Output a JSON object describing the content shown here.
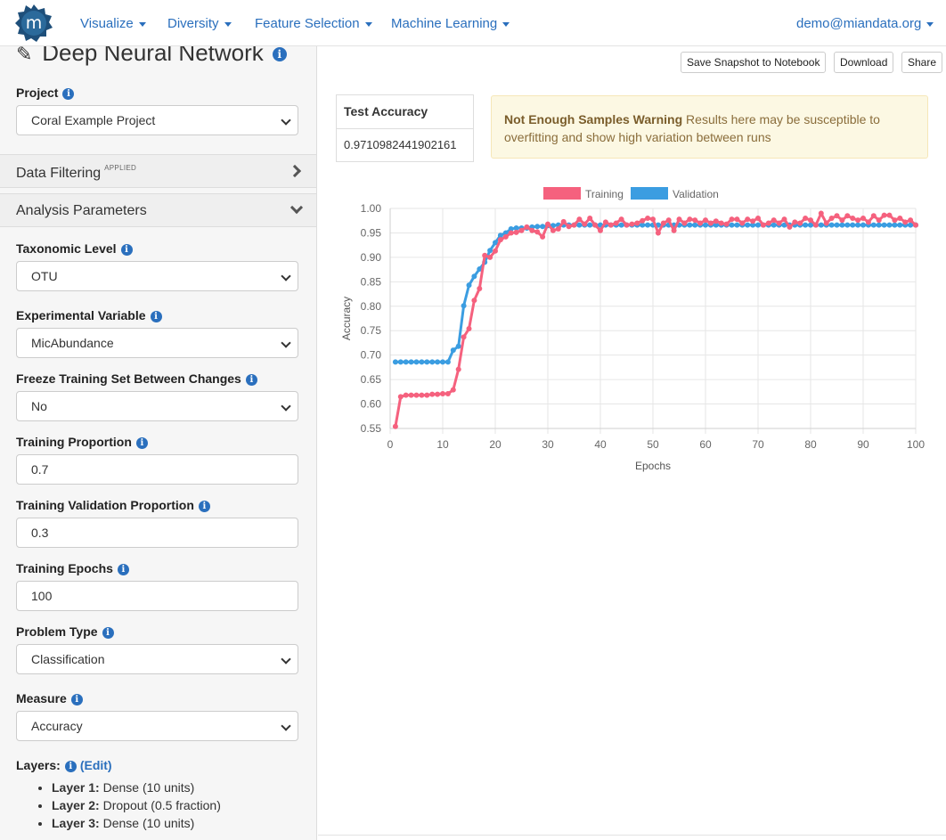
{
  "nav": {
    "logo_letter": "m",
    "items": [
      {
        "label": "Visualize"
      },
      {
        "label": "Diversity"
      },
      {
        "label": "Feature Selection"
      },
      {
        "label": "Machine Learning"
      }
    ],
    "user": "demo@miandata.org"
  },
  "sidebar": {
    "page_title": "Deep Neural Network",
    "project": {
      "label": "Project",
      "value": "Coral Example Project"
    },
    "data_filtering": {
      "title": "Data Filtering",
      "badge": "APPLIED"
    },
    "analysis_parameters": {
      "title": "Analysis Parameters"
    },
    "fields": {
      "taxonomic_level": {
        "label": "Taxonomic Level",
        "value": "OTU"
      },
      "experimental_variable": {
        "label": "Experimental Variable",
        "value": "MicAbundance"
      },
      "freeze_training": {
        "label": "Freeze Training Set Between Changes",
        "value": "No"
      },
      "training_proportion": {
        "label": "Training Proportion",
        "value": "0.7"
      },
      "training_validation_proportion": {
        "label": "Training Validation Proportion",
        "value": "0.3"
      },
      "training_epochs": {
        "label": "Training Epochs",
        "value": "100"
      },
      "problem_type": {
        "label": "Problem Type",
        "value": "Classification"
      },
      "measure": {
        "label": "Measure",
        "value": "Accuracy"
      }
    },
    "layers": {
      "label": "Layers:",
      "edit": "(Edit)",
      "items": [
        {
          "name": "Layer 1:",
          "desc": "Dense (10 units)"
        },
        {
          "name": "Layer 2:",
          "desc": "Dropout (0.5 fraction)"
        },
        {
          "name": "Layer 3:",
          "desc": "Dense (10 units)"
        }
      ]
    }
  },
  "toolbar": {
    "save_snapshot": "Save Snapshot to Notebook",
    "download": "Download",
    "share": "Share"
  },
  "results": {
    "test_accuracy_label": "Test Accuracy",
    "test_accuracy_value": "0.9710982441902161",
    "warning_title": "Not Enough Samples Warning",
    "warning_text": "Results here may be susceptible to overfitting and show high variation between runs"
  },
  "colors": {
    "training": "#f5617e",
    "validation": "#3b9de1",
    "link": "#2a6fbd"
  },
  "chart_data": {
    "type": "line",
    "xlabel": "Epochs",
    "ylabel": "Accuracy",
    "xlim": [
      0,
      100
    ],
    "ylim": [
      0.55,
      1.0
    ],
    "xticks": [
      0,
      10,
      20,
      30,
      40,
      50,
      60,
      70,
      80,
      90,
      100
    ],
    "yticks": [
      0.55,
      0.6,
      0.65,
      0.7,
      0.75,
      0.8,
      0.85,
      0.9,
      0.95,
      1.0
    ],
    "legend_position": "top",
    "grid": true,
    "x": [
      1,
      2,
      3,
      4,
      5,
      6,
      7,
      8,
      9,
      10,
      11,
      12,
      13,
      14,
      15,
      16,
      17,
      18,
      19,
      20,
      21,
      22,
      23,
      24,
      25,
      26,
      27,
      28,
      29,
      30,
      31,
      32,
      33,
      34,
      35,
      36,
      37,
      38,
      39,
      40,
      41,
      42,
      43,
      44,
      45,
      46,
      47,
      48,
      49,
      50,
      51,
      52,
      53,
      54,
      55,
      56,
      57,
      58,
      59,
      60,
      61,
      62,
      63,
      64,
      65,
      66,
      67,
      68,
      69,
      70,
      71,
      72,
      73,
      74,
      75,
      76,
      77,
      78,
      79,
      80,
      81,
      82,
      83,
      84,
      85,
      86,
      87,
      88,
      89,
      90,
      91,
      92,
      93,
      94,
      95,
      96,
      97,
      98,
      99,
      100
    ],
    "series": [
      {
        "name": "Training",
        "values": [
          0.554,
          0.615,
          0.618,
          0.618,
          0.618,
          0.618,
          0.618,
          0.62,
          0.62,
          0.621,
          0.621,
          0.629,
          0.671,
          0.737,
          0.754,
          0.812,
          0.836,
          0.904,
          0.9,
          0.913,
          0.936,
          0.942,
          0.95,
          0.951,
          0.955,
          0.962,
          0.955,
          0.952,
          0.942,
          0.968,
          0.955,
          0.958,
          0.973,
          0.963,
          0.966,
          0.978,
          0.968,
          0.98,
          0.966,
          0.955,
          0.972,
          0.966,
          0.97,
          0.978,
          0.966,
          0.968,
          0.97,
          0.975,
          0.98,
          0.978,
          0.95,
          0.97,
          0.976,
          0.955,
          0.978,
          0.97,
          0.978,
          0.976,
          0.97,
          0.976,
          0.97,
          0.974,
          0.97,
          0.968,
          0.978,
          0.978,
          0.97,
          0.978,
          0.974,
          0.98,
          0.966,
          0.97,
          0.976,
          0.97,
          0.978,
          0.962,
          0.972,
          0.97,
          0.98,
          0.976,
          0.966,
          0.99,
          0.97,
          0.98,
          0.985,
          0.976,
          0.985,
          0.98,
          0.976,
          0.98,
          0.972,
          0.985,
          0.976,
          0.986,
          0.986,
          0.976,
          0.98,
          0.972,
          0.976,
          0.966
        ]
      },
      {
        "name": "Validation",
        "values": [
          0.686,
          0.686,
          0.686,
          0.686,
          0.686,
          0.686,
          0.686,
          0.686,
          0.686,
          0.686,
          0.686,
          0.71,
          0.718,
          0.801,
          0.843,
          0.861,
          0.876,
          0.89,
          0.914,
          0.93,
          0.945,
          0.95,
          0.958,
          0.96,
          0.96,
          0.96,
          0.962,
          0.963,
          0.963,
          0.965,
          0.965,
          0.966,
          0.966,
          0.966,
          0.966,
          0.966,
          0.966,
          0.966,
          0.966,
          0.966,
          0.966,
          0.966,
          0.966,
          0.966,
          0.966,
          0.966,
          0.966,
          0.966,
          0.966,
          0.966,
          0.966,
          0.966,
          0.966,
          0.966,
          0.966,
          0.966,
          0.966,
          0.966,
          0.966,
          0.966,
          0.966,
          0.966,
          0.966,
          0.966,
          0.966,
          0.966,
          0.966,
          0.966,
          0.966,
          0.966,
          0.966,
          0.966,
          0.966,
          0.966,
          0.966,
          0.966,
          0.966,
          0.966,
          0.966,
          0.966,
          0.966,
          0.966,
          0.966,
          0.966,
          0.966,
          0.966,
          0.966,
          0.966,
          0.966,
          0.966,
          0.966,
          0.966,
          0.966,
          0.966,
          0.966,
          0.966,
          0.966,
          0.966,
          0.966,
          0.966
        ]
      }
    ]
  }
}
